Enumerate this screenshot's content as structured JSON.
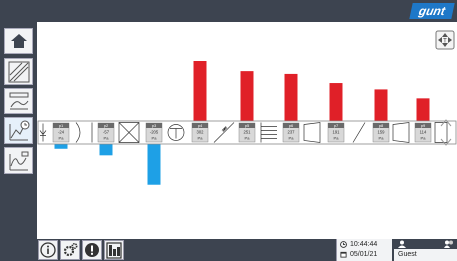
{
  "app": {
    "logo_text": "gunt",
    "brand_color": "#1e78c8"
  },
  "sidebar": {
    "items": [
      {
        "name": "home",
        "icon": "home-icon"
      },
      {
        "name": "diagram-view",
        "icon": "pipe-diagram-icon"
      },
      {
        "name": "measurement-view",
        "icon": "bar-measure-icon"
      },
      {
        "name": "time-chart",
        "icon": "clock-chart-icon"
      },
      {
        "name": "curve-chart",
        "icon": "curve-chart-icon"
      }
    ]
  },
  "main": {
    "zoom_control_icon": "pan-arrows-icon"
  },
  "chart_data": {
    "type": "bar",
    "categories": [
      "p1",
      "p2",
      "p3",
      "p4",
      "p5",
      "p6",
      "p7",
      "p8",
      "p9"
    ],
    "series": [
      {
        "values": [
          -24,
          -57,
          -205,
          302,
          251,
          237,
          191,
          159,
          114
        ]
      }
    ],
    "unit": "Pa",
    "positive_color": "#e02028",
    "negative_color": "#1ea0e6"
  },
  "components": [
    "fan-inlet",
    "nozzle",
    "cross-flow",
    "rotor",
    "heater",
    "tube-bundle",
    "diffuser",
    "orifice",
    "diffuser-2",
    "outlet"
  ],
  "footer": {
    "time": "10:44:44",
    "date": "05/01/21",
    "user": "Guest",
    "buttons": [
      "info-icon",
      "settings-icon",
      "warning-icon",
      "data-export-icon"
    ]
  }
}
